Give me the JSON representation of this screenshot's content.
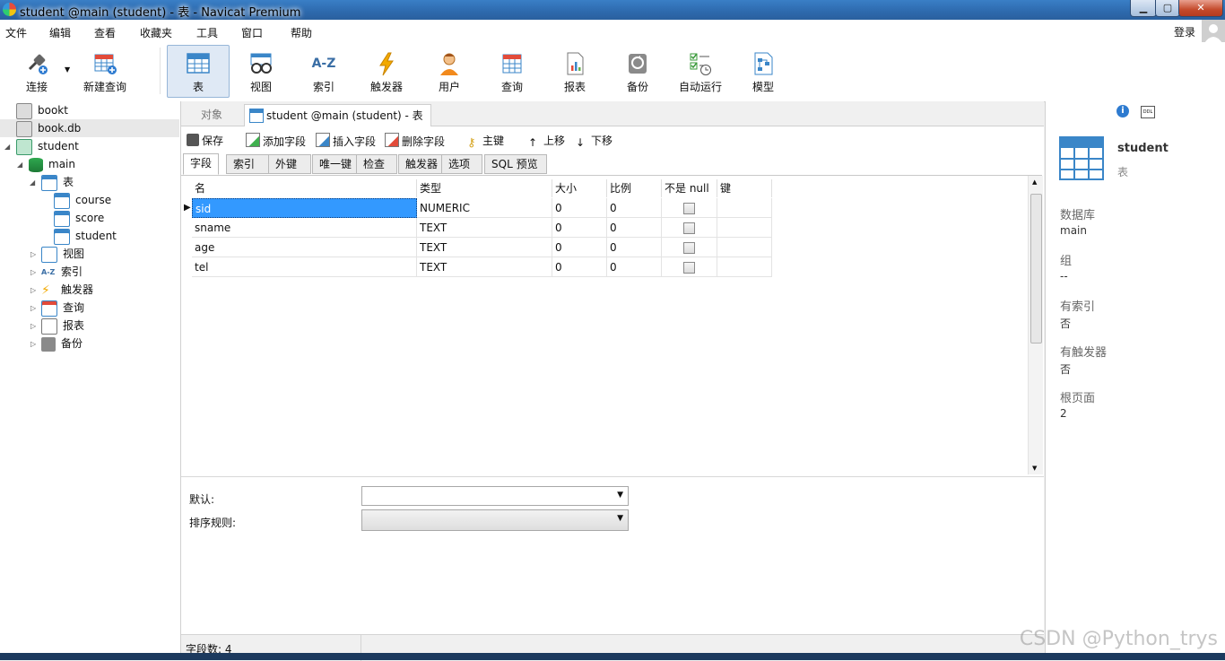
{
  "window": {
    "title": "student @main (student) - 表 - Navicat Premium",
    "minimize_glyph": "▁",
    "maximize_glyph": "▢",
    "close_glyph": "✕"
  },
  "menubar": {
    "items": [
      "文件",
      "编辑",
      "查看",
      "收藏夹",
      "工具",
      "窗口",
      "帮助"
    ],
    "login": "登录"
  },
  "toolbar": {
    "connect": "连接",
    "new_query": "新建查询",
    "table": "表",
    "view": "视图",
    "index": "索引",
    "trigger": "触发器",
    "user": "用户",
    "query": "查询",
    "report": "报表",
    "backup": "备份",
    "auto_run": "自动运行",
    "model": "模型",
    "index_icon_text": "A-Z"
  },
  "sidebar": {
    "connections": [
      "bookt",
      "book.db",
      "student"
    ],
    "database": "main",
    "tables_folder": "表",
    "tables": [
      "course",
      "score",
      "student"
    ],
    "folders": [
      "视图",
      "索引",
      "触发器",
      "查询",
      "报表",
      "备份"
    ]
  },
  "tabs": {
    "objects": "对象",
    "active": "student @main (student) - 表"
  },
  "actions": {
    "save": "保存",
    "add_field": "添加字段",
    "insert_field": "插入字段",
    "delete_field": "删除字段",
    "primary_key": "主键",
    "move_up": "上移",
    "move_down": "下移"
  },
  "subtabs": [
    "字段",
    "索引",
    "外键",
    "唯一键",
    "检查",
    "触发器",
    "选项",
    "SQL 预览"
  ],
  "grid": {
    "headers": [
      "名",
      "类型",
      "大小",
      "比例",
      "不是 null",
      "键"
    ],
    "rows": [
      {
        "name": "sid",
        "type": "NUMERIC",
        "size": "0",
        "scale": "0",
        "not_null": false
      },
      {
        "name": "sname",
        "type": "TEXT",
        "size": "0",
        "scale": "0",
        "not_null": false
      },
      {
        "name": "age",
        "type": "TEXT",
        "size": "0",
        "scale": "0",
        "not_null": false
      },
      {
        "name": "tel",
        "type": "TEXT",
        "size": "0",
        "scale": "0",
        "not_null": false
      }
    ]
  },
  "properties": {
    "default_label": "默认:",
    "collation_label": "排序规则:"
  },
  "status": {
    "field_count": "字段数: 4"
  },
  "info_panel": {
    "name": "student",
    "type": "表",
    "ddl_label": "DDL",
    "info_glyph": "i",
    "fields": [
      {
        "label": "数据库",
        "value": "main"
      },
      {
        "label": "组",
        "value": "--"
      },
      {
        "label": "有索引",
        "value": "否"
      },
      {
        "label": "有触发器",
        "value": "否"
      },
      {
        "label": "根页面",
        "value": "2"
      }
    ]
  },
  "watermark": "CSDN @Python_trys",
  "colors": {
    "selection": "#3399ff",
    "accent": "#2d69ad",
    "table_icon": "#3a86c8"
  }
}
